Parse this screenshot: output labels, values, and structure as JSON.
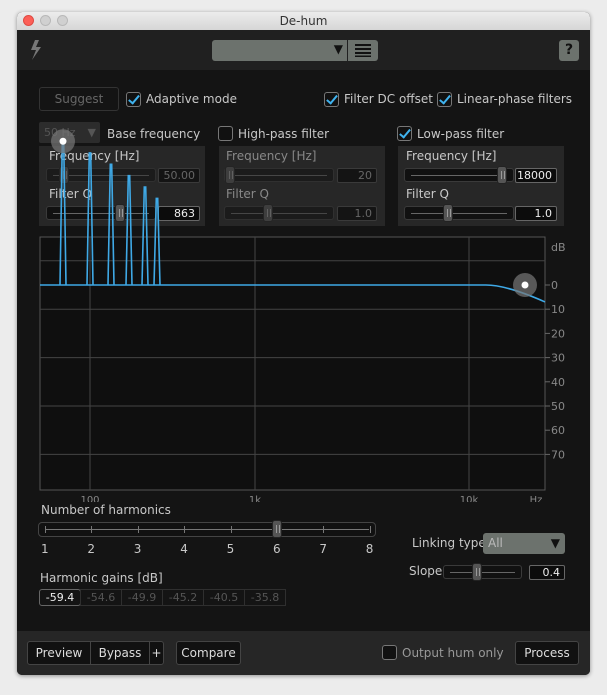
{
  "window": {
    "title": "De-hum"
  },
  "toolbar": {
    "preset_value": "",
    "help_label": "?"
  },
  "options": {
    "suggest": "Suggest",
    "adaptive_mode": "Adaptive mode",
    "adaptive_checked": true,
    "filter_dc": "Filter DC offset",
    "filter_dc_checked": true,
    "linear_phase": "Linear-phase filters",
    "linear_phase_checked": true
  },
  "base": {
    "freq_select": "50 Hz",
    "label": "Base frequency",
    "freq_label": "Frequency [Hz]",
    "freq_value": "50.00",
    "q_label": "Filter Q",
    "q_value": "863"
  },
  "highpass": {
    "label": "High-pass filter",
    "checked": false,
    "freq_label": "Frequency [Hz]",
    "freq_value": "20",
    "q_label": "Filter Q",
    "q_value": "1.0"
  },
  "lowpass": {
    "label": "Low-pass filter",
    "checked": true,
    "freq_label": "Frequency [Hz]",
    "freq_value": "18000",
    "q_label": "Filter Q",
    "q_value": "1.0"
  },
  "graph": {
    "db_unit": "dB",
    "db_ticks": [
      "0",
      "10",
      "20",
      "30",
      "40",
      "50",
      "60",
      "70"
    ],
    "freq_ticks": [
      "100",
      "1k",
      "10k"
    ],
    "hz_unit": "Hz",
    "curve_color": "#3fa9e6",
    "notches": [
      {
        "freq": 50,
        "gain": -59.4
      },
      {
        "freq": 100,
        "gain": -54.6
      },
      {
        "freq": 150,
        "gain": -49.9
      },
      {
        "freq": 200,
        "gain": -45.2
      },
      {
        "freq": 250,
        "gain": -40.5
      },
      {
        "freq": 300,
        "gain": -35.8
      }
    ]
  },
  "harmonics": {
    "label": "Number of harmonics",
    "ticks": [
      "1",
      "2",
      "3",
      "4",
      "5",
      "6",
      "7",
      "8"
    ],
    "value": 6,
    "gains_label": "Harmonic gains [dB]",
    "gains": [
      "-59.4",
      "-54.6",
      "-49.9",
      "-45.2",
      "-40.5",
      "-35.8"
    ]
  },
  "linking": {
    "label": "Linking type",
    "value": "All",
    "slope_label": "Slope",
    "slope_value": "0.4"
  },
  "bottom": {
    "preview": "Preview",
    "bypass": "Bypass",
    "plus": "+",
    "compare": "Compare",
    "output_hum_only": "Output hum only",
    "output_checked": false,
    "process": "Process"
  }
}
